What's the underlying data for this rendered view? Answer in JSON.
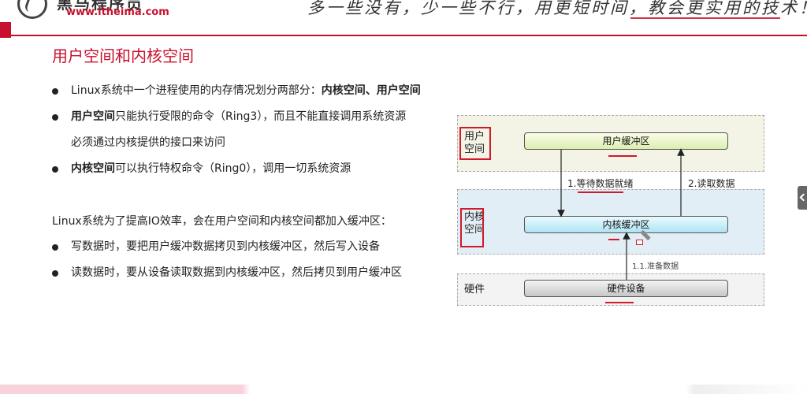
{
  "header": {
    "brand_cn": "黑马程序员",
    "brand_url": "www.itheima.com",
    "slogan": "多一些没有，少一些不行，用更短时间，教会更实用的技术！"
  },
  "slide": {
    "title": "用户空间和内核空间",
    "bullets": [
      {
        "pre": "Linux系统中一个进程使用的内存情况划分两部分：",
        "bold": "内核空间、用户空间",
        "post": ""
      },
      {
        "pre": "",
        "bold": "用户空间",
        "post": "只能执行受限的命令（Ring3），而且不能直接调用系统资源"
      },
      {
        "cont": "必须通过内核提供的接口来访问"
      },
      {
        "pre": "",
        "bold": "内核空间",
        "post": "可以执行特权命令（Ring0），调用一切系统资源"
      }
    ],
    "para": "Linux系统为了提高IO效率，会在用户空间和内核空间都加入缓冲区：",
    "bullets2": [
      "写数据时，要把用户缓冲数据拷贝到内核缓冲区，然后写入设备",
      "读数据时，要从设备读取数据到内核缓冲区，然后拷贝到用户缓冲区"
    ]
  },
  "diagram": {
    "zone_user_label_1": "用户",
    "zone_user_label_2": "空间",
    "zone_kernel_label_1": "内核",
    "zone_kernel_label_2": "空间",
    "zone_hw_label": "硬件",
    "user_buffer": "用户缓冲区",
    "kernel_buffer": "内核缓冲区",
    "hw_device": "硬件设备",
    "arrow_wait": "1.等待数据就绪",
    "arrow_read": "2.读取数据",
    "arrow_prepare": "1.1.准备数据",
    "accent_red": "#d2182b"
  }
}
